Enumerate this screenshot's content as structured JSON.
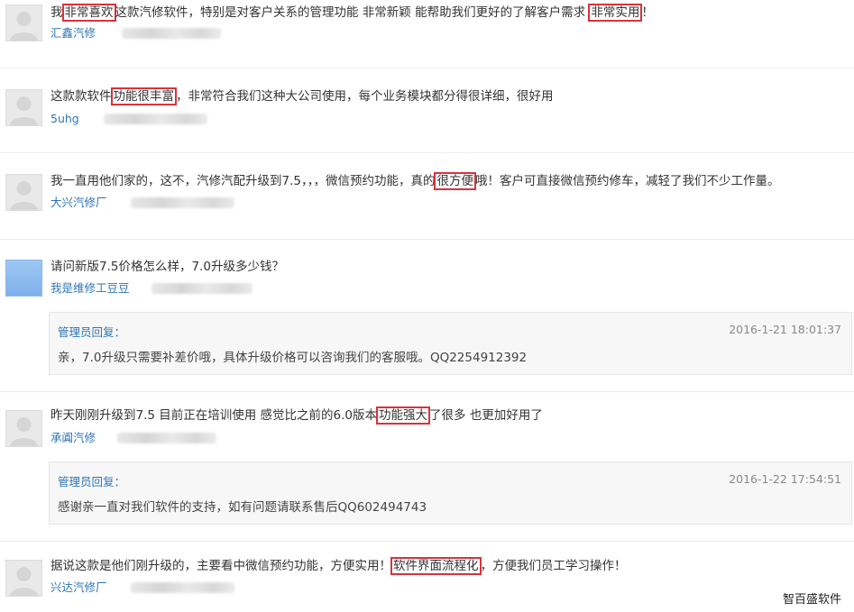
{
  "comments": [
    {
      "text_parts": [
        "我",
        "非常喜欢",
        "这款汽修软件，特别是对客户关系的管理功能 非常新颖 能帮助我们更好的了解客户需求 ",
        "非常实用",
        "！"
      ],
      "user": "汇鑫汽修"
    },
    {
      "text_parts": [
        "这款款软件",
        "功能很丰富",
        "，非常符合我们这种大公司使用，每个业务模块都分得很详细，很好用"
      ],
      "user": "5uhg"
    },
    {
      "text_parts": [
        "我一直用他们家的，这不，汽修汽配升级到7.5，，，微信预约功能，真的",
        "很方便",
        "哦！客户可直接微信预约修车，减轻了我们不少工作量。"
      ],
      "user": "大兴汽修厂"
    },
    {
      "text": "请问新版7.5价格怎么样，7.0升级多少钱？",
      "user": "我是维修工豆豆",
      "reply": {
        "label": "管理员回复：",
        "time": "2016-1-21 18:01:37",
        "text": "亲，7.0升级只需要补差价哦，具体升级价格可以咨询我们的客服哦。QQ2254912392"
      }
    },
    {
      "text_parts": [
        "昨天刚刚升级到7.5 目前正在培训使用 感觉比之前的6.0版本",
        "功能强大",
        "了很多 也更加好用了"
      ],
      "user": "承阗汽修",
      "reply": {
        "label": "管理员回复：",
        "time": "2016-1-22 17:54:51",
        "text": "感谢亲一直对我们软件的支持，如有问题请联系售后QQ602494743"
      }
    },
    {
      "text_parts": [
        "据说这款是他们刚升级的，主要看中微信预约功能，方便实用！",
        "软件界面流程化",
        "，方便我们员工学习操作！"
      ],
      "user": "兴达汽修厂"
    }
  ],
  "watermark": "智百盛软件",
  "colors": {
    "highlight_border": "#d9323c",
    "link": "#2f75b5"
  },
  "icons": {
    "avatar": "default-avatar-icon"
  }
}
